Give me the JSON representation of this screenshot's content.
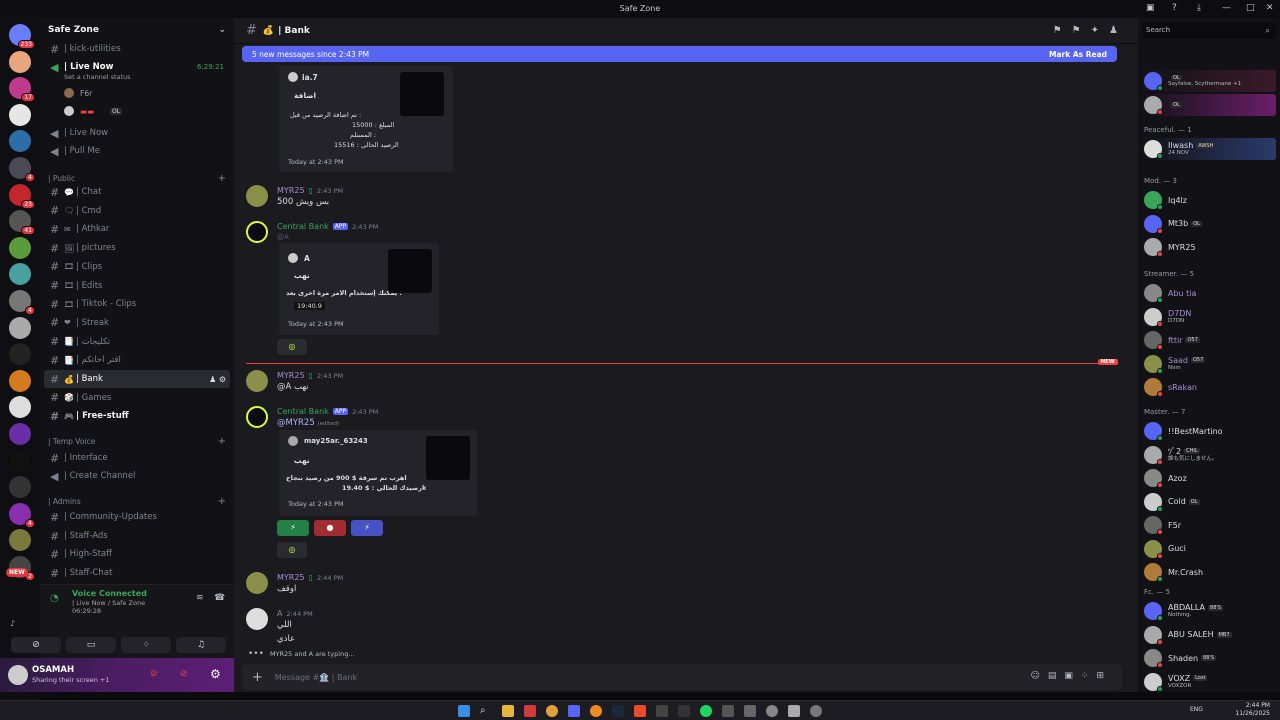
{
  "window": {
    "title": "Safe Zone"
  },
  "servers": [
    {
      "badge": "233",
      "color": "#6a7dff"
    },
    {
      "badge": "",
      "color": "#e8a67f"
    },
    {
      "badge": "17",
      "color": "#c0398f"
    },
    {
      "badge": "",
      "color": "#e6e6e6"
    },
    {
      "badge": "",
      "color": "#2b6ea8"
    },
    {
      "badge": "4",
      "color": "#4a4a55"
    },
    {
      "badge": "23",
      "color": "#c1272d"
    },
    {
      "badge": "41",
      "color": "#555"
    },
    {
      "badge": "",
      "color": "#5a9c3c"
    },
    {
      "badge": "",
      "color": "#4aa0a0"
    },
    {
      "badge": "4",
      "color": "#777"
    },
    {
      "badge": "",
      "color": "#aaa"
    },
    {
      "badge": "",
      "color": "#222"
    },
    {
      "badge": "",
      "color": "#d67a1f"
    },
    {
      "badge": "",
      "color": "#ddd"
    },
    {
      "badge": "",
      "color": "#6a2ea8"
    },
    {
      "badge": "",
      "color": "#111"
    },
    {
      "badge": "",
      "color": "#333"
    },
    {
      "badge": "4",
      "color": "#8a2eb0"
    },
    {
      "badge": "",
      "color": "#7a7a3c"
    },
    {
      "badge": "2",
      "color": "#444"
    }
  ],
  "sidebar": {
    "guild_name": "Safe Zone",
    "top_channels": [
      {
        "label": "| kick-utilities"
      },
      {
        "label": "| Live Now",
        "time": "6:29:21",
        "status": "Set a channel status"
      }
    ],
    "voice_users": [
      {
        "name": "F6r"
      },
      {
        "name": "",
        "tag": "OL"
      }
    ],
    "voice_channels": [
      {
        "label": "| Live Now"
      },
      {
        "label": "| Pull Me"
      }
    ],
    "public_label": "| Public",
    "public_channels": [
      {
        "label": "| Chat"
      },
      {
        "label": "| Cmd"
      },
      {
        "label": "| Athkar"
      },
      {
        "label": "| pictures"
      },
      {
        "label": "| Clips"
      },
      {
        "label": "| Edits"
      },
      {
        "label": "| Tiktok - Clips"
      },
      {
        "label": "| Streak"
      },
      {
        "label": "| تكليجات"
      },
      {
        "label": "| اقتر احاتكم"
      },
      {
        "label": "| Bank"
      },
      {
        "label": "| Games"
      },
      {
        "label": "| Free-stuff"
      }
    ],
    "temp_label": "| Temp Voice",
    "temp_channels": [
      {
        "label": "| Interface"
      },
      {
        "label": "| Create Channel"
      }
    ],
    "admins_label": "| Admins",
    "admin_channels": [
      {
        "label": "| Community-Updates"
      },
      {
        "label": "| Staff-Ads"
      },
      {
        "label": "| High-Staff"
      },
      {
        "label": "| Staff-Chat"
      }
    ],
    "new_badge": "NEW"
  },
  "voice": {
    "connected": "Voice Connected",
    "location": "| Live Now / Safe Zone",
    "time": "06:29:28"
  },
  "user": {
    "name": "OSAMAH",
    "status": "Sharing their screen +1"
  },
  "channel": {
    "name": "| Bank",
    "new_messages": "5 new messages since 2:43 PM",
    "mark_read": "Mark As Read",
    "new_divider": "NEW",
    "composer_placeholder": "Message #🏦 | Bank",
    "typing": "MYR25 and A are typing..."
  },
  "messages": {
    "e1": {
      "author": "ia.7",
      "title": "اضافة",
      "l1": "تم اضافة الرصيد من قبل :",
      "l2": "المبلغ : 15000",
      "l3": "المستلم :",
      "l4": "الرصيد الحالي : 15516",
      "time": "Today at 2:43 PM"
    },
    "m1": {
      "author": "MYR25",
      "time": "2:43 PM",
      "text": "500 بس ويش"
    },
    "m2": {
      "author": "Central Bank",
      "app": "APP",
      "time": "2:43 PM",
      "mention": "@A",
      "e_author": "A",
      "e_title": "نهب",
      "e_l1": "يمكنك إستخدام الامر مرة اخرى بعد :",
      "e_l2": "19:40.9",
      "e_time": "Today at 2:43 PM"
    },
    "m3": {
      "author": "MYR25",
      "time": "2:43 PM",
      "text": "@A نهب"
    },
    "m4": {
      "author": "Central Bank",
      "app": "APP",
      "time": "2:43 PM",
      "mention": "@MYR25",
      "edited": "(edited)",
      "e_author": "may25ar._63243",
      "e_title": "نهب",
      "e_l1": "اهرب تم سرقة $ 900 من رصيد بنجاح",
      "e_l2": "رصيدك الحالي : $ 19.40k",
      "e_time": "Today at 2:43 PM"
    },
    "m5": {
      "author": "MYR25",
      "time": "2:44 PM",
      "text": "اوقف"
    },
    "m6": {
      "author": "A",
      "time": "2:44 PM",
      "l1": "اللي",
      "l2": "عادي"
    }
  },
  "members": {
    "search_placeholder": "Search",
    "top": [
      {
        "name": "",
        "sub": "Sayfalse, Scythermane +1",
        "tag": "OL"
      },
      {
        "name": "",
        "sub": "",
        "tag": "OL"
      }
    ],
    "peaceful_label": "Peaceful. — 1",
    "peaceful": [
      {
        "name": "Ilwash",
        "sub": "24 NOV",
        "tag": "AWSH"
      }
    ],
    "mod_label": "Mod. — 3",
    "mod": [
      {
        "name": "Iq4lz",
        "tag": ""
      },
      {
        "name": "Mt3b",
        "tag": "OL"
      },
      {
        "name": "MYR25",
        "tag": ""
      }
    ],
    "streamer_label": "Streamer. — 5",
    "streamer": [
      {
        "name": "Abu tia",
        "sub": ""
      },
      {
        "name": "D7DN",
        "sub": "D7DN"
      },
      {
        "name": "fttir",
        "sub": "",
        "tag": "O57"
      },
      {
        "name": "Saad",
        "sub": "Nvm",
        "tag": "O57"
      },
      {
        "name": "sRakan",
        "sub": ""
      }
    ],
    "master_label": "Master. — 7",
    "master": [
      {
        "name": "!!BestMartino",
        "sub": ""
      },
      {
        "name": "ﾂﾞ2",
        "sub": "誰も気にしません。",
        "tag": "CHIL"
      },
      {
        "name": "Azoz",
        "sub": ""
      },
      {
        "name": "Cold",
        "sub": "",
        "tag": "OL"
      },
      {
        "name": "F5r",
        "sub": ""
      },
      {
        "name": "Guci",
        "sub": ""
      },
      {
        "name": "Mr.Crash",
        "sub": ""
      }
    ],
    "fc_label": "Fc. — 5",
    "fc": [
      {
        "name": "ABDALLA",
        "sub": "Nothing.",
        "tag": "88'S"
      },
      {
        "name": "ABU SALEH",
        "sub": "",
        "tag": "MB7"
      },
      {
        "name": "Shaden",
        "sub": "",
        "tag": "88'S"
      },
      {
        "name": "VOXZ",
        "sub": "VOXZOR",
        "tag": "Lost"
      }
    ]
  },
  "taskbar": {
    "lang": "ENG",
    "time": "2:44 PM",
    "date": "11/26/2025"
  },
  "colors": {
    "blurple": "#5865f2",
    "online": "#23a55a",
    "dnd": "#f23f42",
    "bank_green": "#d6ff3a"
  }
}
